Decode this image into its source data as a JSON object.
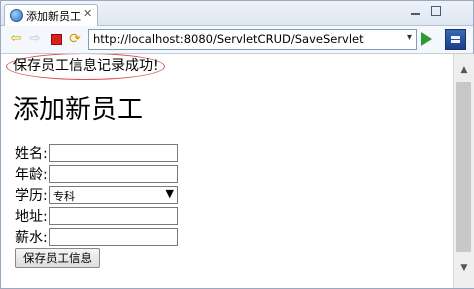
{
  "tab": {
    "title": "添加新员工",
    "close": "✕"
  },
  "toolbar": {
    "back": "⇦",
    "forward": "⇨",
    "refresh": "⟳",
    "url": "http://localhost:8080/ServletCRUD/SaveServlet",
    "url_dropdown": "▾"
  },
  "page": {
    "message": "保存员工信息记录成功!",
    "heading": "添加新员工",
    "fields": {
      "name_label": "姓名:",
      "age_label": "年龄:",
      "education_label": "学历:",
      "education_value": "专科",
      "education_arrow": "▼",
      "address_label": "地址:",
      "salary_label": "薪水:"
    },
    "submit_label": "保存员工信息"
  },
  "scrollbar": {
    "up": "▲",
    "down": "▼"
  },
  "colors": {
    "highlight_circle": "#d9534f",
    "go": "#2e9a2e",
    "stop": "#d92020"
  }
}
